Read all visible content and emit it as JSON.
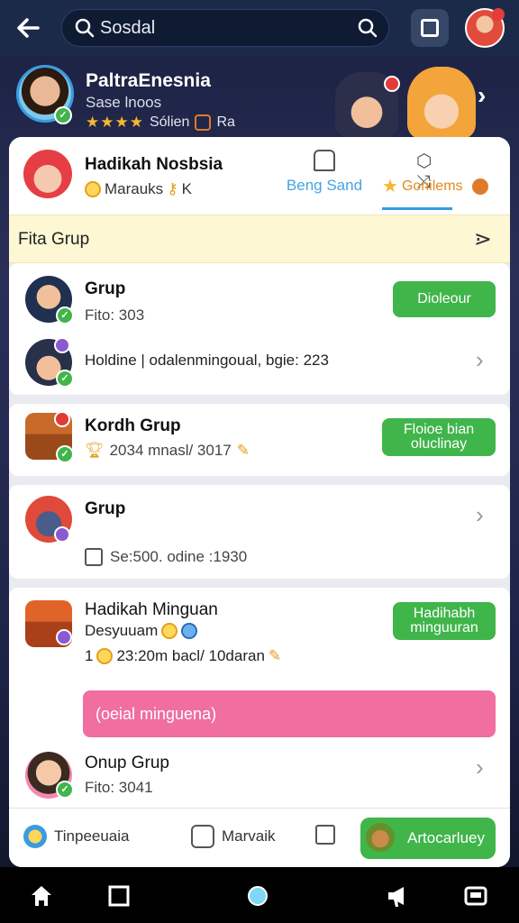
{
  "topbar": {
    "search_value": "Sosdal"
  },
  "profile": {
    "name": "PaltraEnesnia",
    "subtitle": "Sase lnoos",
    "stars": "★★★★",
    "rating_text": "Sólien",
    "rating_extra": "Ra"
  },
  "tabs": {
    "title": "Hadikah Nosbsia",
    "sub": "Marauks",
    "sub_suffix": "K",
    "mid_label": "Beng Sand",
    "right_label": "Gonilems"
  },
  "section": {
    "title": "Fita Grup"
  },
  "items": [
    {
      "title": "Grup",
      "sub": "Fito: 303",
      "button": "Dioleour"
    },
    {
      "title": "",
      "sub": "Holdine | odalenmingoual, bgie: 223"
    },
    {
      "title": "Kordh Grup",
      "sub": "2034 mnasl/ 3017",
      "button_line1": "Floioe bian",
      "button_line2": "oluclinay"
    },
    {
      "title": "Grup",
      "sub": "Se:500. odine :1930"
    },
    {
      "title": "Hadikah Minguan",
      "sub": "Desyuuam",
      "sub2": "23:20m bacl/ 10daran",
      "sub2_prefix": "1",
      "button_line1": "Hadihabh",
      "button_line2": "minguuran"
    },
    {
      "title": "Onup Grup",
      "sub": "Fito: 3041"
    }
  ],
  "pink_bar": {
    "text": "(oeial minguena)"
  },
  "bottom_tabs": {
    "left": "Tinpeeuaia",
    "mid": "Marvaik",
    "right": "Artocarluey"
  },
  "colors": {
    "accent_green": "#3fb54a",
    "accent_blue": "#3a9be0",
    "pink": "#f06ea0",
    "header": "#1c2a4a"
  }
}
